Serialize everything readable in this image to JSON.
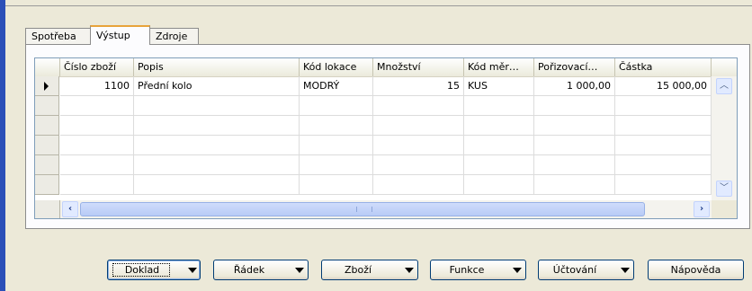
{
  "tabs": [
    "Spotřeba",
    "Výstup",
    "Zdroje"
  ],
  "active_tab": "Výstup",
  "grid": {
    "columns": [
      "Číslo zboží",
      "Popis",
      "Kód lokace",
      "Množství",
      "Kód měr…",
      "Pořizovací…",
      "Částka"
    ],
    "rows": [
      {
        "cislo": "1100",
        "popis": "Přední kolo",
        "lokace": "MODRÝ",
        "mnozstvi": "15",
        "kod_mer": "KUS",
        "porizovaci": "1 000,00",
        "castka": "15 000,00"
      }
    ]
  },
  "buttons": {
    "doklad": "Doklad",
    "radek": "Řádek",
    "zbozi": "Zboží",
    "funkce": "Funkce",
    "uctovani": "Účtování",
    "napoveda": "Nápověda"
  },
  "colors": {
    "window_bg": "#ece9d8",
    "accent_bar": "#2b4fb8",
    "tab_highlight": "#e8a33a"
  }
}
